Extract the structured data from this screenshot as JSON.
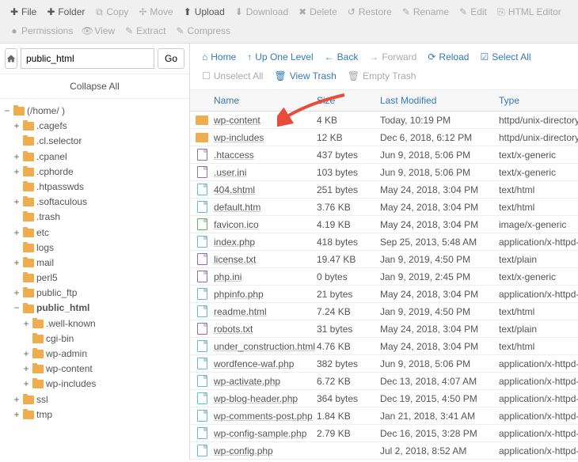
{
  "toolbar": {
    "row1": [
      {
        "icon": "plus",
        "label": "File",
        "enabled": true
      },
      {
        "icon": "plus",
        "label": "Folder",
        "enabled": true
      },
      {
        "icon": "copy",
        "label": "Copy",
        "enabled": false
      },
      {
        "icon": "move",
        "label": "Move",
        "enabled": false
      },
      {
        "icon": "upload",
        "label": "Upload",
        "enabled": true
      },
      {
        "icon": "download",
        "label": "Download",
        "enabled": false
      },
      {
        "icon": "x",
        "label": "Delete",
        "enabled": false
      },
      {
        "icon": "restore",
        "label": "Restore",
        "enabled": false
      },
      {
        "icon": "rename",
        "label": "Rename",
        "enabled": false
      },
      {
        "icon": "edit",
        "label": "Edit",
        "enabled": false
      },
      {
        "icon": "html",
        "label": "HTML Editor",
        "enabled": false
      }
    ],
    "row2": [
      {
        "icon": "perm",
        "label": "Permissions",
        "enabled": false
      },
      {
        "icon": "view",
        "label": "View",
        "enabled": false
      },
      {
        "icon": "extract",
        "label": "Extract",
        "enabled": false
      },
      {
        "icon": "compress",
        "label": "Compress",
        "enabled": false
      }
    ]
  },
  "path": {
    "value": "public_html",
    "go": "Go"
  },
  "collapse": "Collapse All",
  "tree": [
    {
      "toggle": "−",
      "indent": 0,
      "label": "(/home/           )",
      "bold": false
    },
    {
      "toggle": "+",
      "indent": 1,
      "label": ".cagefs"
    },
    {
      "toggle": "",
      "indent": 1,
      "label": ".cl.selector"
    },
    {
      "toggle": "+",
      "indent": 1,
      "label": ".cpanel"
    },
    {
      "toggle": "+",
      "indent": 1,
      "label": ".cphorde"
    },
    {
      "toggle": "",
      "indent": 1,
      "label": ".htpasswds"
    },
    {
      "toggle": "+",
      "indent": 1,
      "label": ".softaculous"
    },
    {
      "toggle": "",
      "indent": 1,
      "label": ".trash"
    },
    {
      "toggle": "+",
      "indent": 1,
      "label": "etc"
    },
    {
      "toggle": "",
      "indent": 1,
      "label": "logs"
    },
    {
      "toggle": "+",
      "indent": 1,
      "label": "mail"
    },
    {
      "toggle": "",
      "indent": 1,
      "label": "perl5"
    },
    {
      "toggle": "+",
      "indent": 1,
      "label": "public_ftp"
    },
    {
      "toggle": "−",
      "indent": 1,
      "label": "public_html",
      "bold": true
    },
    {
      "toggle": "+",
      "indent": 2,
      "label": ".well-known"
    },
    {
      "toggle": "",
      "indent": 2,
      "label": "cgi-bin"
    },
    {
      "toggle": "+",
      "indent": 2,
      "label": "wp-admin"
    },
    {
      "toggle": "+",
      "indent": 2,
      "label": "wp-content"
    },
    {
      "toggle": "+",
      "indent": 2,
      "label": "wp-includes"
    },
    {
      "toggle": "+",
      "indent": 1,
      "label": "ssl"
    },
    {
      "toggle": "+",
      "indent": 1,
      "label": "tmp"
    }
  ],
  "actions": {
    "row1": [
      {
        "icon": "home",
        "label": "Home",
        "enabled": true
      },
      {
        "icon": "up",
        "label": "Up One Level",
        "enabled": true
      },
      {
        "icon": "back",
        "label": "Back",
        "enabled": true
      },
      {
        "icon": "forward",
        "label": "Forward",
        "enabled": false
      },
      {
        "icon": "reload",
        "label": "Reload",
        "enabled": true
      },
      {
        "icon": "check",
        "label": "Select All",
        "enabled": true
      }
    ],
    "row2": [
      {
        "icon": "uncheck",
        "label": "Unselect All",
        "enabled": false
      },
      {
        "icon": "trash",
        "label": "View Trash",
        "enabled": true
      },
      {
        "icon": "trash",
        "label": "Empty Trash",
        "enabled": false
      }
    ]
  },
  "columns": {
    "name": "Name",
    "size": "Size",
    "mod": "Last Modified",
    "type": "Type"
  },
  "files": [
    {
      "icon": "folder",
      "name": "wp-content",
      "size": "4 KB",
      "mod": "Today, 10:19 PM",
      "type": "httpd/unix-directory"
    },
    {
      "icon": "folder",
      "name": "wp-includes",
      "size": "12 KB",
      "mod": "Dec 6, 2018, 6:12 PM",
      "type": "httpd/unix-directory"
    },
    {
      "icon": "txt",
      "name": ".htaccess",
      "size": "437 bytes",
      "mod": "Jun 9, 2018, 5:06 PM",
      "type": "text/x-generic"
    },
    {
      "icon": "txt",
      "name": ".user.ini",
      "size": "103 bytes",
      "mod": "Jun 9, 2018, 5:06 PM",
      "type": "text/x-generic"
    },
    {
      "icon": "code",
      "name": "404.shtml",
      "size": "251 bytes",
      "mod": "May 24, 2018, 3:04 PM",
      "type": "text/html"
    },
    {
      "icon": "code",
      "name": "default.htm",
      "size": "3.76 KB",
      "mod": "May 24, 2018, 3:04 PM",
      "type": "text/html"
    },
    {
      "icon": "img",
      "name": "favicon.ico",
      "size": "4.19 KB",
      "mod": "May 24, 2018, 3:04 PM",
      "type": "image/x-generic"
    },
    {
      "icon": "code",
      "name": "index.php",
      "size": "418 bytes",
      "mod": "Sep 25, 2013, 5:48 AM",
      "type": "application/x-httpd-p"
    },
    {
      "icon": "txt",
      "name": "license.txt",
      "size": "19.47 KB",
      "mod": "Jan 9, 2019, 4:50 PM",
      "type": "text/plain"
    },
    {
      "icon": "txt",
      "name": "php.ini",
      "size": "0 bytes",
      "mod": "Jan 9, 2019, 2:45 PM",
      "type": "text/x-generic"
    },
    {
      "icon": "code",
      "name": "phpinfo.php",
      "size": "21 bytes",
      "mod": "May 24, 2018, 3:04 PM",
      "type": "application/x-httpd-p"
    },
    {
      "icon": "code",
      "name": "readme.html",
      "size": "7.24 KB",
      "mod": "Jan 9, 2019, 4:50 PM",
      "type": "text/html"
    },
    {
      "icon": "txt",
      "name": "robots.txt",
      "size": "31 bytes",
      "mod": "May 24, 2018, 3:04 PM",
      "type": "text/plain"
    },
    {
      "icon": "code",
      "name": "under_construction.html",
      "size": "4.76 KB",
      "mod": "May 24, 2018, 3:04 PM",
      "type": "text/html"
    },
    {
      "icon": "code",
      "name": "wordfence-waf.php",
      "size": "382 bytes",
      "mod": "Jun 9, 2018, 5:06 PM",
      "type": "application/x-httpd-p"
    },
    {
      "icon": "code",
      "name": "wp-activate.php",
      "size": "6.72 KB",
      "mod": "Dec 13, 2018, 4:07 AM",
      "type": "application/x-httpd-p"
    },
    {
      "icon": "code",
      "name": "wp-blog-header.php",
      "size": "364 bytes",
      "mod": "Dec 19, 2015, 4:50 PM",
      "type": "application/x-httpd-p"
    },
    {
      "icon": "code",
      "name": "wp-comments-post.php",
      "size": "1.84 KB",
      "mod": "Jan 21, 2018, 3:41 AM",
      "type": "application/x-httpd-p"
    },
    {
      "icon": "code",
      "name": "wp-config-sample.php",
      "size": "2.79 KB",
      "mod": "Dec 16, 2015, 3:28 PM",
      "type": "application/x-httpd-p"
    },
    {
      "icon": "code",
      "name": "wp-config.php",
      "size": "",
      "mod": "Jul 2, 2018, 8:52 AM",
      "type": "application/x-httpd-p"
    }
  ]
}
